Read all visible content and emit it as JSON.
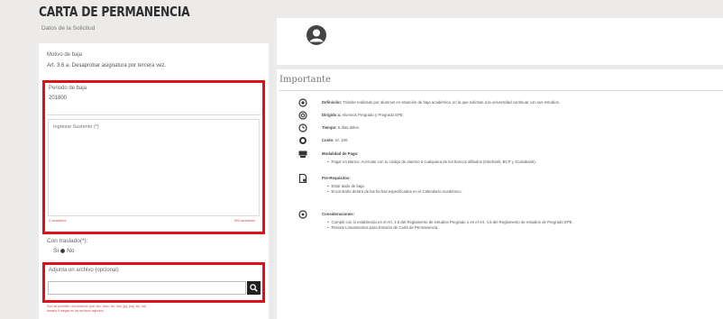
{
  "header": {
    "title": "CARTA DE PERMANENCIA",
    "subtitle": "Datos de la Solicitud"
  },
  "form": {
    "motivo_label": "Motivo de baja",
    "motivo_value": "Art. 3.6 a. Desaprobar asignatura por tercera vez.",
    "periodo_label": "Periodo de baja",
    "periodo_value": "201800",
    "sustento_placeholder": "Ingresar Sustento (*)",
    "sustento_hint_left": "0 caracteres",
    "sustento_hint_right": "500 caracteres",
    "traslado_label": "Con traslado(*):",
    "traslado_options": [
      "Sí",
      "No"
    ],
    "adjunta_label": "Adjunta un archivo (opcional)",
    "footnote": [
      "Solo se permiten: documentos (pdf, doc, docx, xls, xlsx, jpg, png, zip, rar).",
      "tamaño 5 megas en los archivos adjuntos."
    ]
  },
  "info": {
    "title": "Importante",
    "items": [
      {
        "icon": "definition-icon",
        "bold": "Definición:",
        "text": " Trámite realizado por alumnos en situación de baja académica, en la que solicitan a la universidad continuar con sus estudios."
      },
      {
        "icon": "target-icon",
        "bold": "Dirigido a:",
        "text": " Alumnos Pregrado y Pregrado EPE."
      },
      {
        "icon": "clock-icon",
        "bold": "Tiempo:",
        "text": " 5 días útiles."
      },
      {
        "icon": "coin-icon",
        "bold": "Costo:",
        "text": " S/. 100."
      },
      {
        "icon": "card-icon",
        "bold": "Modalidad de Pago:",
        "text": ""
      },
      {
        "icon": "document-icon",
        "bold": "Pre-Requisitos:",
        "text": ""
      },
      {
        "icon": "info-circle-icon",
        "bold": "Consideraciones:",
        "text": ""
      }
    ],
    "pago_bullets": [
      "Pagar en Banco: Acércate con tu código de alumno a cualquiera de los bancos afiliados (Interbank, BCP y Scotiabank)."
    ],
    "prereq_bullets": [
      "Estar dado de baja.",
      "Encontrarte dentro de las fechas especificadas en el Calendario Académico."
    ],
    "consid_bullets": [
      "Cumplir con lo establecido en el Art. 4.5 del Reglamento de estudios Pregrado o en el Art. 4.5 del Reglamento de estudios de Pregrado EPE.",
      "Revisar Lineamientos para Emisión de Carta de Permanencia."
    ]
  },
  "colors": {
    "highlight": "#e0101a",
    "panel": "#ffffff",
    "background": "#ecebea"
  }
}
